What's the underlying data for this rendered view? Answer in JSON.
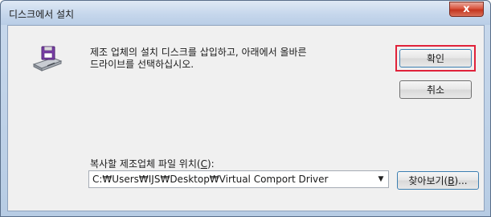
{
  "window": {
    "title": "디스크에서 설치",
    "close_label": "x"
  },
  "message": {
    "line1": "제조 업체의 설치 디스크를 삽입하고, 아래에서 올바른",
    "line2": "드라이브를 선택하십시오."
  },
  "buttons": {
    "ok_label": "확인",
    "cancel_label": "취소",
    "browse_prefix": "찾아보기(",
    "browse_accel": "B",
    "browse_suffix": ")..."
  },
  "path": {
    "label_prefix": "복사할 제조업체 파일 위치(",
    "label_accel": "C",
    "label_suffix": "):",
    "value": "C:₩Users₩IJS₩Desktop₩Virtual Comport Driver"
  },
  "icons": {
    "install": "disk-drive-icon",
    "dropdown": "chevron-down-icon"
  },
  "colors": {
    "highlight": "#e0223a",
    "close_button": "#c4361f",
    "title_bar": "#c6d7ec"
  }
}
